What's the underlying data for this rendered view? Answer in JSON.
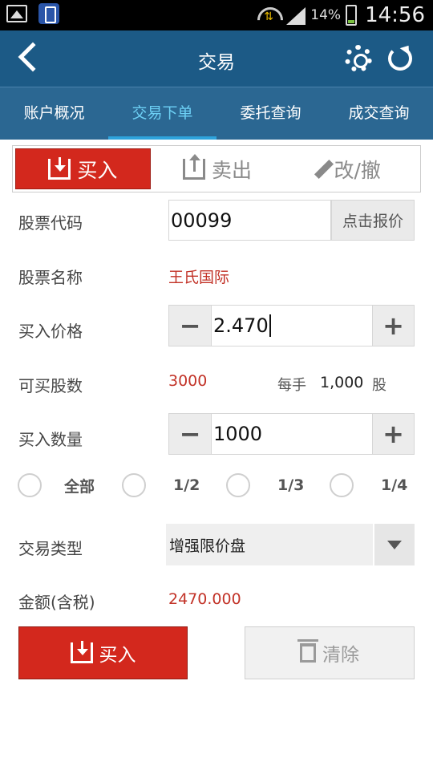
{
  "status_bar": {
    "battery": "14%",
    "time": "14:56"
  },
  "header": {
    "title": "交易"
  },
  "tabs": [
    {
      "label": "账户概况"
    },
    {
      "label": "交易下单"
    },
    {
      "label": "委托查询"
    },
    {
      "label": "成交查询"
    }
  ],
  "segments": [
    {
      "label": "买入"
    },
    {
      "label": "卖出"
    },
    {
      "label": "改/撤"
    }
  ],
  "form": {
    "stock_code_label": "股票代码",
    "stock_code_value": "00099",
    "quote_button": "点击报价",
    "stock_name_label": "股票名称",
    "stock_name_value": "王氏国际",
    "price_label": "买入价格",
    "price_value": "2.470",
    "buyable_label": "可买股数",
    "buyable_value": "3000",
    "lot_label": "每手",
    "lot_value": "1,000",
    "lot_unit": "股",
    "quantity_label": "买入数量",
    "quantity_value": "1000",
    "ratios": [
      "全部",
      "1/2",
      "1/3",
      "1/4"
    ],
    "type_label": "交易类型",
    "type_value": "增强限价盘",
    "amount_label": "金额(含税)",
    "amount_value": "2470.000",
    "minus": "−",
    "plus": "+"
  },
  "actions": {
    "buy": "买入",
    "clear": "清除"
  }
}
